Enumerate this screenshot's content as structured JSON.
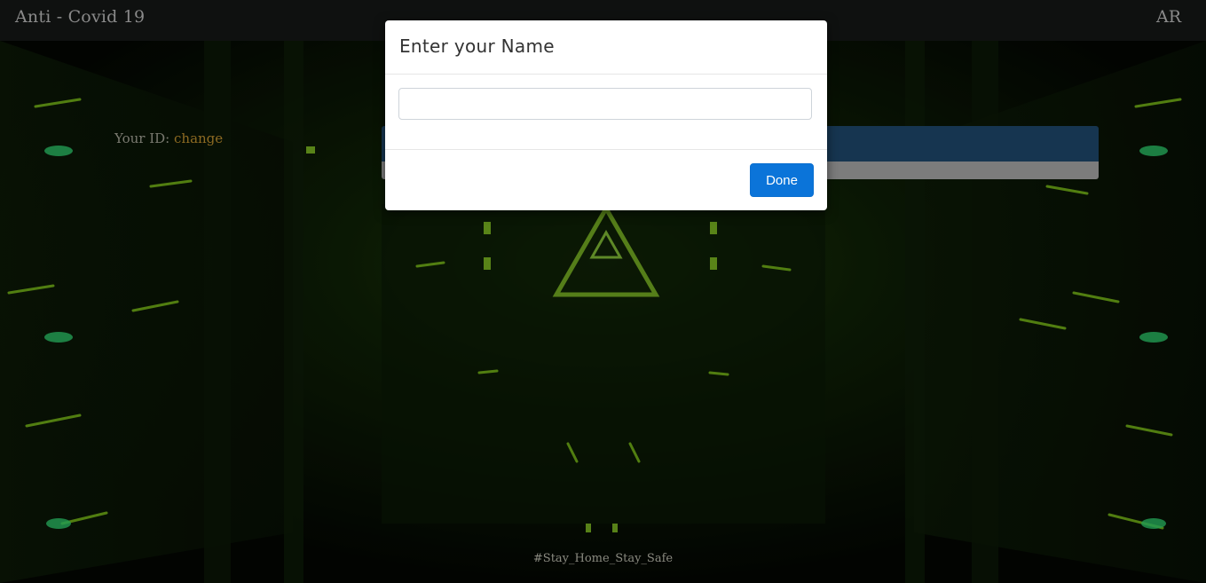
{
  "navbar": {
    "brand": "Anti - Covid 19",
    "language": "AR"
  },
  "main": {
    "id_label": "Your ID:",
    "change_link": "change"
  },
  "footer": {
    "hashtag": "#Stay_Home_Stay_Safe"
  },
  "modal": {
    "title": "Enter your Name",
    "name_value": "",
    "name_placeholder": "",
    "done_label": "Done"
  },
  "colors": {
    "navbar_bg": "#0f1110",
    "primary_button": "#0b74d9",
    "bar_top": "#163550",
    "bar_bottom": "#7c7c7c",
    "change_link": "#8d6a22"
  }
}
